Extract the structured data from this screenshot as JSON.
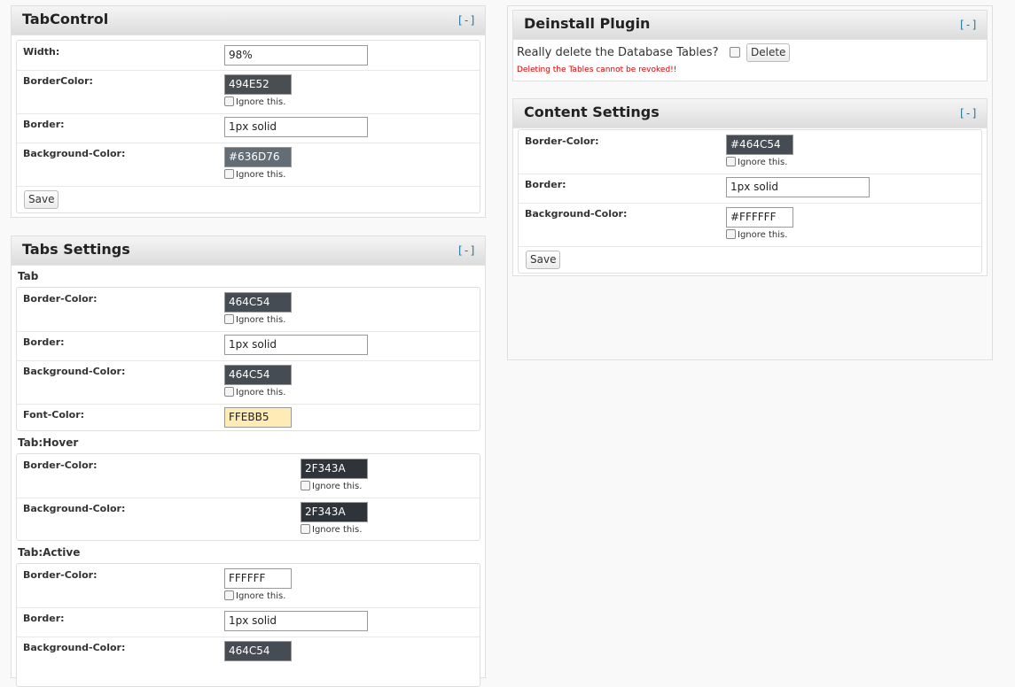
{
  "tabcontrol": {
    "title": "TabControl",
    "toggle": "[-]",
    "width_label": "Width:",
    "width_value": "98%",
    "bordercolor_label": "BorderColor:",
    "bordercolor_value": "494E52",
    "bordercolor_bg": "#494E52",
    "border_label": "Border:",
    "border_value": "1px solid",
    "bgcolor_label": "Background-Color:",
    "bgcolor_value": "#636D76",
    "bgcolor_bg": "#636D76",
    "ignore": "Ignore this.",
    "save": "Save"
  },
  "tabs_settings": {
    "title": "Tabs Settings",
    "toggle": "[-]",
    "ignore": "Ignore this.",
    "tab": {
      "heading": "Tab",
      "border_color_label": "Border-Color:",
      "border_color_value": "464C54",
      "border_color_bg": "#464C54",
      "border_label": "Border:",
      "border_value": "1px solid",
      "bg_color_label": "Background-Color:",
      "bg_color_value": "464C54",
      "bg_color_bg": "#464C54",
      "font_color_label": "Font-Color:",
      "font_color_value": "FFEBB5",
      "font_color_bg": "#FFEBB5"
    },
    "hover": {
      "heading": "Tab:Hover",
      "border_color_label": "Border-Color:",
      "border_color_value": "2F343A",
      "border_color_bg": "#2F343A",
      "bg_color_label": "Background-Color:",
      "bg_color_value": "2F343A",
      "bg_color_bg": "#2F343A"
    },
    "active": {
      "heading": "Tab:Active",
      "border_color_label": "Border-Color:",
      "border_color_value": "FFFFFF",
      "border_color_bg": "#FFFFFF",
      "border_label": "Border:",
      "border_value": "1px solid",
      "bg_color_label": "Background-Color:",
      "bg_color_value": "464C54",
      "bg_color_bg": "#464C54"
    }
  },
  "deinstall": {
    "title": "Deinstall Plugin",
    "toggle": "[-]",
    "question": "Really delete the Database Tables?",
    "delete_button": "Delete",
    "warning": "Deleting the Tables cannot be revoked!!"
  },
  "content_settings": {
    "title": "Content Settings",
    "toggle": "[-]",
    "border_color_label": "Border-Color:",
    "border_color_value": "#464C54",
    "border_color_bg": "#464C54",
    "border_label": "Border:",
    "border_value": "1px solid",
    "bg_color_label": "Background-Color:",
    "bg_color_value": "#FFFFFF",
    "bg_color_bg": "#FFFFFF",
    "ignore": "Ignore this.",
    "save": "Save"
  }
}
